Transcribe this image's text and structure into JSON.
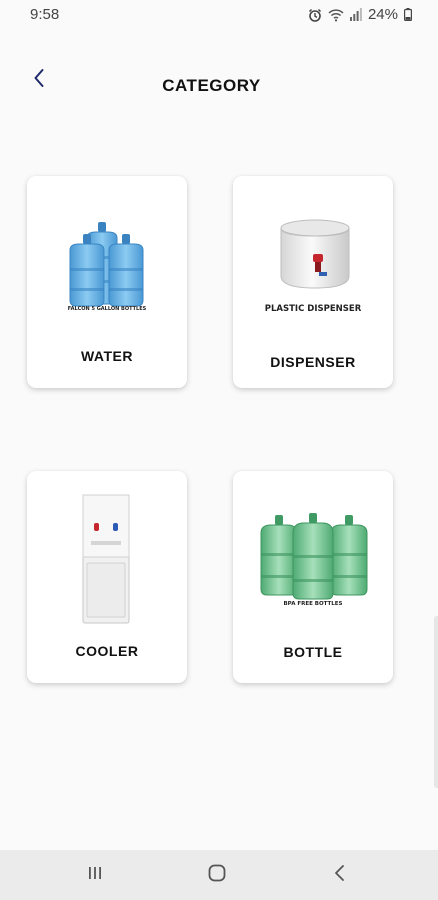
{
  "status_bar": {
    "time": "9:58",
    "battery": "24%"
  },
  "header": {
    "title": "CATEGORY"
  },
  "categories": [
    {
      "label": "WATER",
      "image_caption": "FALCON 5 GALLON BOTTLES"
    },
    {
      "label": "DISPENSER",
      "image_caption": "PLASTIC DISPENSER"
    },
    {
      "label": "COOLER"
    },
    {
      "label": "BOTTLE",
      "image_caption": "BPA FREE BOTTLES"
    }
  ],
  "icons": {
    "back": "chevron-left-icon",
    "alarm": "alarm-icon",
    "wifi": "wifi-icon",
    "signal": "signal-icon",
    "battery": "battery-icon",
    "nav_recent": "recent-apps-icon",
    "nav_home": "home-icon",
    "nav_back": "back-icon"
  },
  "colors": {
    "accent": "#1f2a6b",
    "water": "#6cb4e6",
    "bottle": "#79c79a"
  }
}
